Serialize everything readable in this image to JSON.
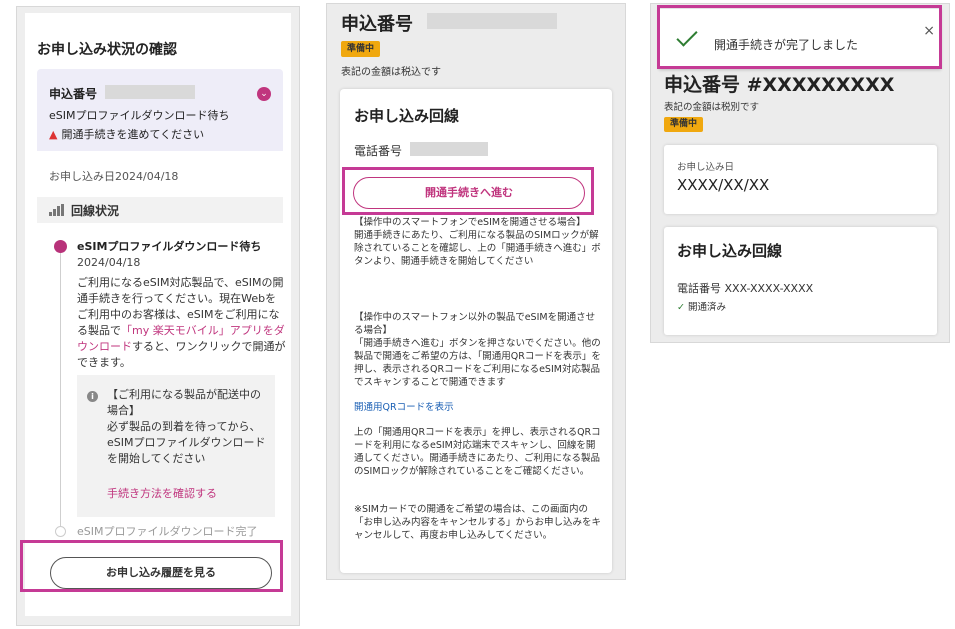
{
  "panel1": {
    "title": "お申し込み状況の確認",
    "application_label": "申込番号",
    "status": "eSIMプロファイルダウンロード待ち",
    "warning": "開通手続きを進めてください",
    "application_date": "お申し込み日2024/04/18",
    "line_status_label": "回線状況",
    "step1_title": "eSIMプロファイルダウンロード待ち",
    "step1_date": "2024/04/18",
    "step1_desc_a": "ご利用になるeSIM対応製品で、eSIMの開通手続きを行ってください。現在Webをご利用中のお客様は、eSIMをご利用になる製品で",
    "step1_desc_link": "「my 楽天モバイル」アプリをダウンロード",
    "step1_desc_b": "すると、ワンクリックで開通ができます。",
    "note_head": "【ご利用になる製品が配送中の場合】",
    "note_body": "必ず製品の到着を待ってから、eSIMプロファイルダウンロードを開始してください",
    "note_link": "手続き方法を確認する",
    "step2_title": "eSIMプロファイルダウンロード完了",
    "history_button": "お申し込み履歴を見る"
  },
  "panel2": {
    "application_label": "申込番号",
    "badge": "準備中",
    "tax_note": "表記の金額は税込です",
    "card_title": "お申し込み回線",
    "phone_label": "電話番号",
    "proceed_button": "開通手続きへ進む",
    "para1": "【操作中のスマートフォンでeSIMを開通させる場合】\n開通手続きにあたり、ご利用になる製品のSIMロックが解除されていることを確認し、上の「開通手続きへ進む」ボタンより、開通手続きを開始してください",
    "para2": "【操作中のスマートフォン以外の製品でeSIMを開通させる場合】\n「開通手続きへ進む」ボタンを押さないでください。他の製品で開通をご希望の方は、「開通用QRコードを表示」を押し、表示されるQRコードをご利用になるeSIM対応製品でスキャンすることで開通できます",
    "qr_link": "開通用QRコードを表示",
    "para3": "上の「開通用QRコードを表示」を押し、表示されるQRコードを利用になるeSIM対応端末でスキャンし、回線を開通してください。開通手続きにあたり、ご利用になる製品のSIMロックが解除されていることをご確認ください。",
    "para4": "※SIMカードでの開通をご希望の場合は、この画面内の「お申し込み内容をキャンセルする」からお申し込みをキャンセルして、再度お申し込みしてください。"
  },
  "panel3": {
    "toast_message": "開通手続きが完了しました",
    "close_icon": "×",
    "application_title": "申込番号 #XXXXXXXXX",
    "tax_note": "表記の金額は税別です",
    "badge": "準備中",
    "date_label": "お申し込み日",
    "date_value": "XXXX/XX/XX",
    "card_title": "お申し込み回線",
    "phone": "電話番号 XXX-XXXX-XXXX",
    "opened": "開通済み"
  },
  "colors": {
    "accent": "#c0357e",
    "highlight": "#c53a95",
    "badge": "#f0a80f",
    "success": "#2e7d32",
    "link": "#1a5fb4"
  }
}
